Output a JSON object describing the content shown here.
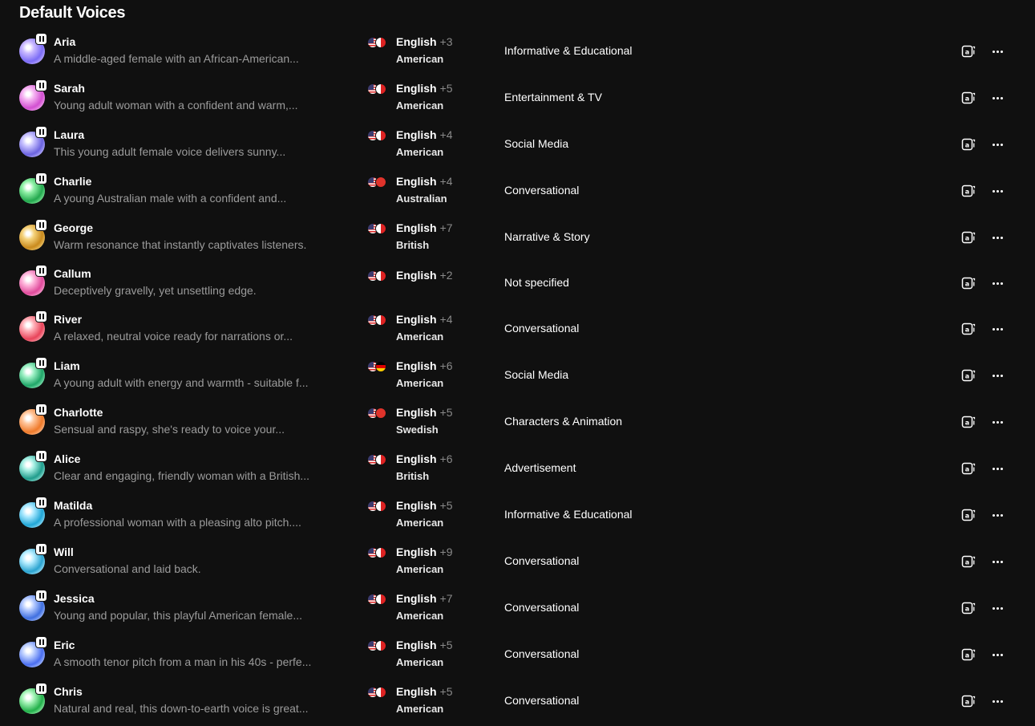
{
  "section_title": "Default Voices",
  "icons": {
    "avatar": "gradient-orb-avatar",
    "pause": "pause-icon",
    "translate": "translate-icon",
    "more": "more-horizontal-icon"
  },
  "voices": [
    {
      "name": "Aria",
      "description": "A middle-aged female with an African-American...",
      "language": "English",
      "more_languages": "+3",
      "accent": "American",
      "category": "Informative & Educational",
      "avatar_colors": [
        "#7b6cf6",
        "#c9b8ff"
      ],
      "flag2": "fr"
    },
    {
      "name": "Sarah",
      "description": "Young adult woman with a confident and warm,...",
      "language": "English",
      "more_languages": "+5",
      "accent": "American",
      "category": "Entertainment & TV",
      "avatar_colors": [
        "#d24fd1",
        "#f6b4f2"
      ],
      "flag2": "fr"
    },
    {
      "name": "Laura",
      "description": "This young adult female voice delivers sunny...",
      "language": "English",
      "more_languages": "+4",
      "accent": "American",
      "category": "Social Media",
      "avatar_colors": [
        "#6b63e0",
        "#c8c2ff"
      ],
      "flag2": "fr"
    },
    {
      "name": "Charlie",
      "description": "A young Australian male with a confident and...",
      "language": "English",
      "more_languages": "+4",
      "accent": "Australian",
      "category": "Conversational",
      "avatar_colors": [
        "#23a84e",
        "#8ef0a5"
      ],
      "flag2": "au"
    },
    {
      "name": "George",
      "description": "Warm resonance that instantly captivates listeners.",
      "language": "English",
      "more_languages": "+7",
      "accent": "British",
      "category": "Narrative & Story",
      "avatar_colors": [
        "#c98a1d",
        "#f5d27a"
      ],
      "flag2": "fr"
    },
    {
      "name": "Callum",
      "description": "Deceptively gravelly, yet unsettling edge.",
      "language": "English",
      "more_languages": "+2",
      "accent": "",
      "category": "Not specified",
      "avatar_colors": [
        "#e04a9b",
        "#ffb6dc"
      ],
      "flag2": "fr"
    },
    {
      "name": "River",
      "description": "A relaxed, neutral voice ready for narrations or...",
      "language": "English",
      "more_languages": "+4",
      "accent": "American",
      "category": "Conversational",
      "avatar_colors": [
        "#e8445a",
        "#ffb0b8"
      ],
      "flag2": "fr"
    },
    {
      "name": "Liam",
      "description": "A young adult with energy and warmth - suitable f...",
      "language": "English",
      "more_languages": "+6",
      "accent": "American",
      "category": "Social Media",
      "avatar_colors": [
        "#1fa668",
        "#9cf0c4"
      ],
      "flag2": "de"
    },
    {
      "name": "Charlotte",
      "description": "Sensual and raspy, she's ready to voice your...",
      "language": "English",
      "more_languages": "+5",
      "accent": "Swedish",
      "category": "Characters & Animation",
      "avatar_colors": [
        "#ef7a2a",
        "#ffc59a"
      ],
      "flag2": "se"
    },
    {
      "name": "Alice",
      "description": "Clear and engaging, friendly woman with a British...",
      "language": "English",
      "more_languages": "+6",
      "accent": "British",
      "category": "Advertisement",
      "avatar_colors": [
        "#1f9c8c",
        "#a6efe3"
      ],
      "flag2": "fr"
    },
    {
      "name": "Matilda",
      "description": "A professional woman with a pleasing alto pitch....",
      "language": "English",
      "more_languages": "+5",
      "accent": "American",
      "category": "Informative & Educational",
      "avatar_colors": [
        "#20a6d6",
        "#a8e8ff"
      ],
      "flag2": "fr"
    },
    {
      "name": "Will",
      "description": "Conversational and laid back.",
      "language": "English",
      "more_languages": "+9",
      "accent": "American",
      "category": "Conversational",
      "avatar_colors": [
        "#2aa3d0",
        "#b3ecff"
      ],
      "flag2": "fr"
    },
    {
      "name": "Jessica",
      "description": "Young and popular, this playful American female...",
      "language": "English",
      "more_languages": "+7",
      "accent": "American",
      "category": "Conversational",
      "avatar_colors": [
        "#3f6fe0",
        "#b6cbff"
      ],
      "flag2": "fr"
    },
    {
      "name": "Eric",
      "description": "A smooth tenor pitch from a man in his 40s - perfe...",
      "language": "English",
      "more_languages": "+5",
      "accent": "American",
      "category": "Conversational",
      "avatar_colors": [
        "#4a6ef0",
        "#bdd0ff"
      ],
      "flag2": "fr"
    },
    {
      "name": "Chris",
      "description": "Natural and real, this down-to-earth voice is great...",
      "language": "English",
      "more_languages": "+5",
      "accent": "American",
      "category": "Conversational",
      "avatar_colors": [
        "#22b04a",
        "#a6f5b8"
      ],
      "flag2": "fr"
    }
  ]
}
